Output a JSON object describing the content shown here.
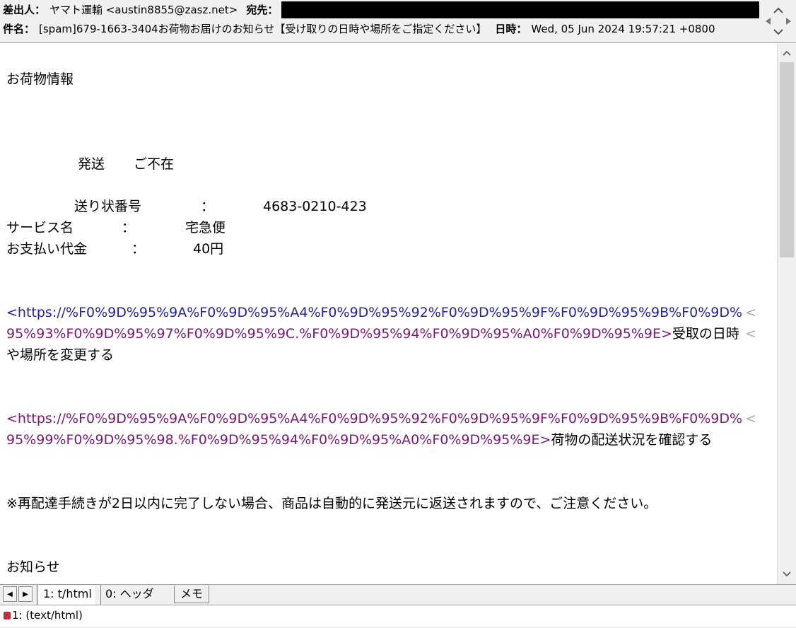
{
  "header": {
    "from_label": "差出人：",
    "from_value": "ヤマト運輸 <austin8855@zasz.net>",
    "to_label": "宛先：",
    "subject_label": "件名：",
    "subject_value": "[spam]679-1663-3404お荷物お届けのお知らせ【受け取りの日時や場所をご指定ください】",
    "date_label": "日時：",
    "date_value": "Wed, 05 Jun 2024 19:57:21 +0800"
  },
  "body": {
    "title": "お荷物情報",
    "status1": "発送",
    "status2": "ご不在",
    "tracking_label": "送り状番号",
    "tracking_colon": "：",
    "tracking_value": "4683-0210-423",
    "service_label": "サービス名",
    "service_colon": "：",
    "service_value": "宅急便",
    "payment_label": "お支払い代金",
    "payment_colon": "：",
    "payment_value": "40円",
    "link1_part1": "<https://%F0%9D%95%9A%F0%9D%95%A4%F0%9D%95%92%F0%9D%95%9F%F0%9D%95%9B%F0%9D%",
    "link1_part2": "95%93%F0%9D%95%97%F0%9D%95%9C.%F0%9D%95%94%F0%9D%95%A0%F0%9D%95%9E>",
    "link1_text1": "受取の日時",
    "link1_text2": "や場所を変更する",
    "link2_part1": "<https://%F0%9D%95%9A%F0%9D%95%A4%F0%9D%95%92%F0%9D%95%9F%F0%9D%95%9B%F0%9D%",
    "link2_part2": "95%99%F0%9D%95%98.%F0%9D%95%94%F0%9D%95%A0%F0%9D%95%9E>",
    "link2_text": "荷物の配送状況を確認する",
    "notice": "※再配達手続きが2日以内に完了しない場合、商品は自動的に発送元に返送されますので、ご注意ください。",
    "footer_title": "お知らせ",
    "wrap_mark": "<"
  },
  "tabs": {
    "tab1": "1: t/html",
    "tab2": "0: ヘッダ",
    "tab3": "メモ"
  },
  "status": {
    "text": "1: (text/html)"
  },
  "colors": {
    "link_blue": "#2222aa",
    "link_purple": "#7a1877"
  }
}
